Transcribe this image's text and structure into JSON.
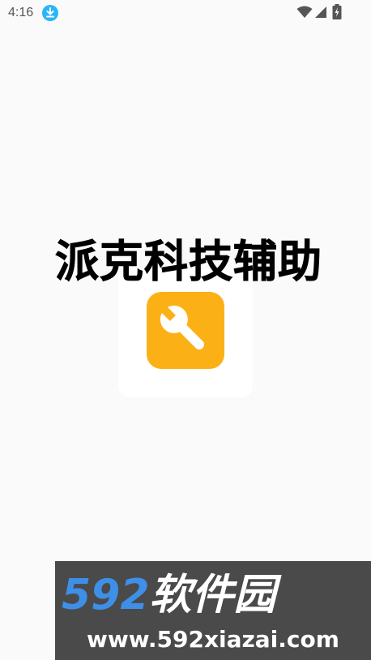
{
  "status_bar": {
    "time": "4:16",
    "icons": [
      "download-notification-icon",
      "wifi-icon",
      "cellular-signal-icon",
      "battery-charging-icon"
    ],
    "download_icon_color": "#29b6f6"
  },
  "splash": {
    "app_name": "派克科技辅助",
    "icon": "wrench-icon",
    "icon_background_color": "#fbb116",
    "icon_glyph_color": "#ffffff"
  },
  "watermark": {
    "brand_number": "592",
    "brand_text": "软件园",
    "url": "www.592xiazai.com",
    "number_color": "#3e8fe8"
  }
}
